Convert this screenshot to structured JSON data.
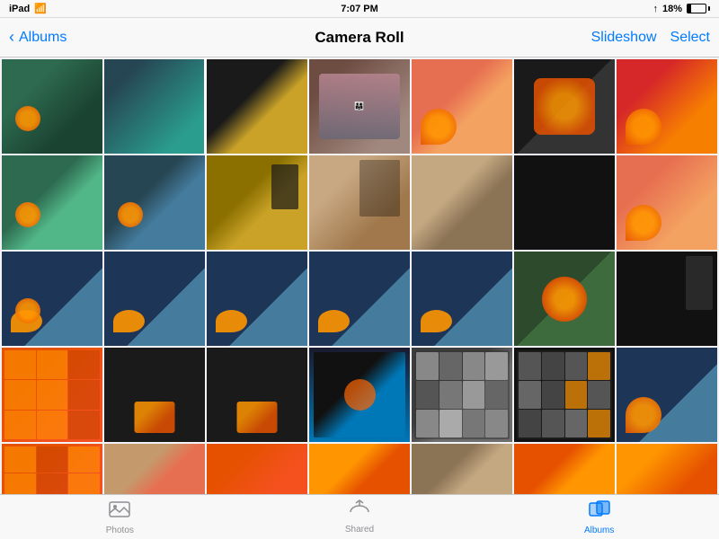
{
  "status_bar": {
    "device": "iPad",
    "time": "7:07 PM",
    "signal": "iPad",
    "wifi": true,
    "battery_percent": "18%",
    "battery_icon": "battery"
  },
  "nav_bar": {
    "back_label": "Albums",
    "title": "Camera Roll",
    "slideshow_label": "Slideshow",
    "select_label": "Select"
  },
  "tab_bar": {
    "tabs": [
      {
        "id": "photos",
        "label": "Photos",
        "icon": "◻",
        "active": false
      },
      {
        "id": "shared",
        "label": "Shared",
        "icon": "☁",
        "active": false
      },
      {
        "id": "albums",
        "label": "Albums",
        "icon": "▣",
        "active": true
      }
    ]
  },
  "photos": {
    "rows": [
      [
        "p1",
        "p2",
        "p3",
        "p4",
        "p5",
        "p6",
        "p7"
      ],
      [
        "p8",
        "p9",
        "p10",
        "p11",
        "p12",
        "p13",
        "p14"
      ],
      [
        "p15",
        "p16",
        "p17",
        "p18",
        "p19",
        "p20",
        "p21"
      ],
      [
        "p22",
        "p23",
        "p24",
        "p25",
        "p26",
        "p27",
        "p28"
      ],
      [
        "p29",
        "p30",
        "p31",
        "p32",
        "p33",
        "p34",
        "p35"
      ]
    ]
  }
}
